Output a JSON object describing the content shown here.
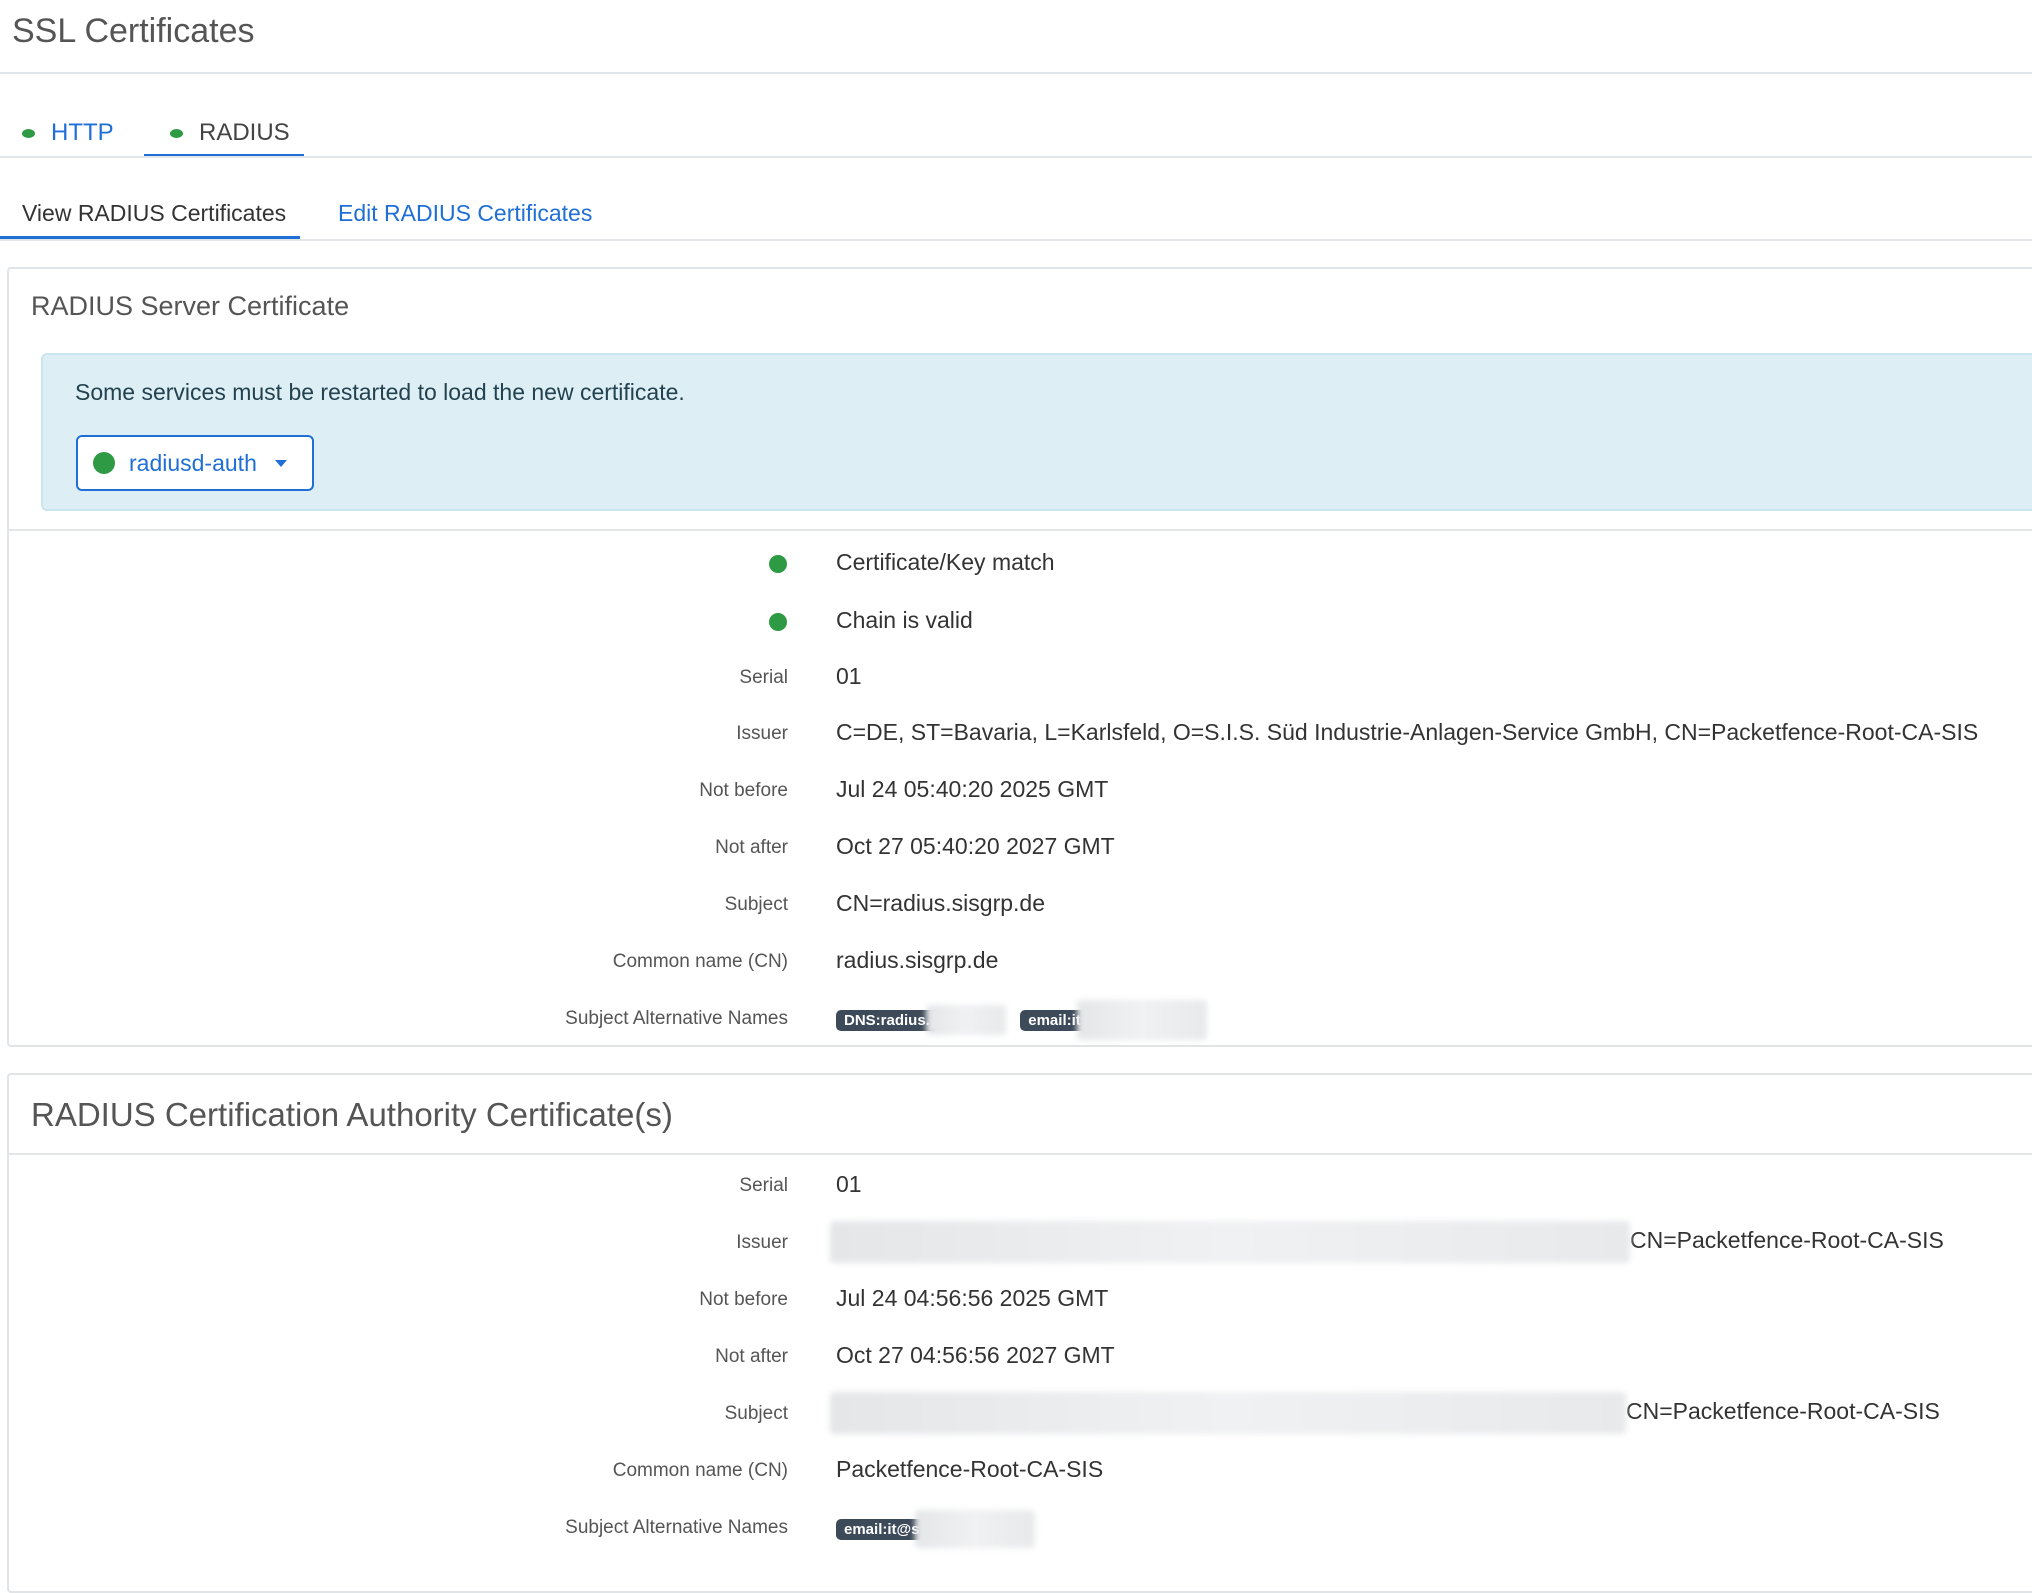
{
  "page": {
    "title": "SSL Certificates"
  },
  "protocol_tabs": [
    {
      "label": "HTTP",
      "status_color": "#2e9a43"
    },
    {
      "label": "RADIUS",
      "status_color": "#2e9a43"
    }
  ],
  "sub_tabs": {
    "view": "View RADIUS Certificates",
    "edit": "Edit RADIUS Certificates"
  },
  "server_cert": {
    "title": "RADIUS Server Certificate",
    "alert_text": "Some services must be restarted to load the new certificate.",
    "service_button": "radiusd-auth",
    "status": [
      "Certificate/Key match",
      "Chain is valid"
    ],
    "labels": {
      "serial": "Serial",
      "issuer": "Issuer",
      "not_before": "Not before",
      "not_after": "Not after",
      "subject": "Subject",
      "cn": "Common name (CN)",
      "san": "Subject Alternative Names"
    },
    "serial": "01",
    "issuer": "C=DE, ST=Bavaria, L=Karlsfeld, O=S.I.S. Süd Industrie-Anlagen-Service GmbH, CN=Packetfence-Root-CA-SIS",
    "not_before": "Jul 24 05:40:20 2025 GMT",
    "not_after": "Oct 27 05:40:20 2027 GMT",
    "subject": "CN=radius.sisgrp.de",
    "cn": "radius.sisgrp.de",
    "san": [
      "DNS:radius.",
      "email:it"
    ]
  },
  "ca_cert": {
    "title": "RADIUS Certification Authority Certificate(s)",
    "labels": {
      "serial": "Serial",
      "issuer": "Issuer",
      "not_before": "Not before",
      "not_after": "Not after",
      "subject": "Subject",
      "cn": "Common name (CN)",
      "san": "Subject Alternative Names"
    },
    "serial": "01",
    "issuer_visible": "CN=Packetfence-Root-CA-SIS",
    "not_before": "Jul 24 04:56:56 2025 GMT",
    "not_after": "Oct 27 04:56:56 2027 GMT",
    "subject_visible": "CN=Packetfence-Root-CA-SIS",
    "cn": "Packetfence-Root-CA-SIS",
    "san": [
      "email:it@s"
    ]
  }
}
